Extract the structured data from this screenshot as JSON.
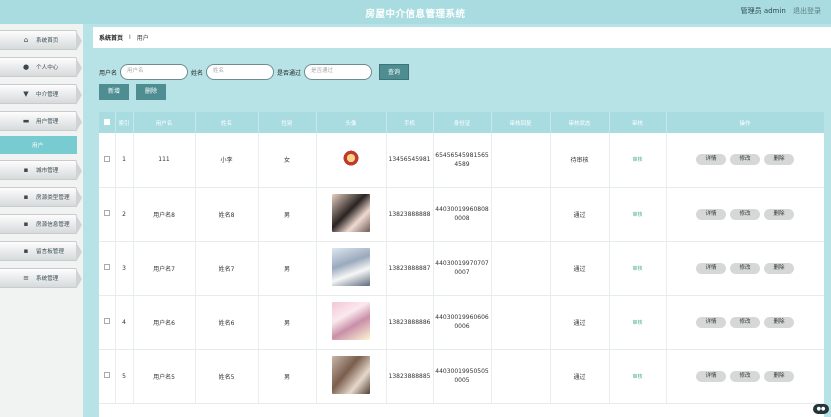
{
  "app": {
    "title": "房屋中介信息管理系统"
  },
  "header": {
    "user_label": "管理员 admin",
    "logout": "退出登录"
  },
  "sidebar": {
    "items": [
      {
        "label": "系统首页",
        "icon": "home-icon"
      },
      {
        "label": "个人中心",
        "icon": "user-icon"
      },
      {
        "label": "中介管理",
        "icon": "trophy-icon"
      },
      {
        "label": "用户管理",
        "icon": "briefcase-icon",
        "submenu": "用户"
      },
      {
        "label": "城市管理",
        "icon": "grid-icon"
      },
      {
        "label": "房源类型管理",
        "icon": "grid-icon"
      },
      {
        "label": "房源信息管理",
        "icon": "grid-icon"
      },
      {
        "label": "留言板管理",
        "icon": "grid-icon"
      },
      {
        "label": "系统管理",
        "icon": "list-icon"
      }
    ]
  },
  "breadcrumb": {
    "home": "系统首页",
    "separator": "I",
    "current": "用户"
  },
  "search": {
    "fields": [
      {
        "label": "用户名",
        "placeholder": "用户名"
      },
      {
        "label": "姓名",
        "placeholder": "姓名"
      },
      {
        "label": "是否通过",
        "placeholder": "是否通过"
      }
    ],
    "button": "查询"
  },
  "actions": {
    "add": "新增",
    "delete": "删除"
  },
  "table": {
    "headers": [
      "",
      "索引",
      "用户名",
      "姓名",
      "性别",
      "头像",
      "手机",
      "身份证",
      "审核回复",
      "审核状态",
      "审核",
      "操作"
    ],
    "rows": [
      {
        "index": "1",
        "username": "111",
        "name": "小李",
        "gender": "女",
        "phone": "13456545981",
        "id_card_1": "65456545981565",
        "id_card_2": "4589",
        "reply": "",
        "status": "待审核",
        "review": "审核"
      },
      {
        "index": "2",
        "username": "用户名8",
        "name": "姓名8",
        "gender": "男",
        "phone": "13823888888",
        "id_card_1": "44030019960808",
        "id_card_2": "0008",
        "reply": "",
        "status": "通过",
        "review": "审核"
      },
      {
        "index": "3",
        "username": "用户名7",
        "name": "姓名7",
        "gender": "男",
        "phone": "13823888887",
        "id_card_1": "44030019970707",
        "id_card_2": "0007",
        "reply": "",
        "status": "通过",
        "review": "审核"
      },
      {
        "index": "4",
        "username": "用户名6",
        "name": "姓名6",
        "gender": "男",
        "phone": "13823888886",
        "id_card_1": "44030019960606",
        "id_card_2": "0006",
        "reply": "",
        "status": "通过",
        "review": "审核"
      },
      {
        "index": "5",
        "username": "用户名5",
        "name": "姓名5",
        "gender": "男",
        "phone": "13823888885",
        "id_card_1": "44030019950505",
        "id_card_2": "0005",
        "reply": "",
        "status": "通过",
        "review": "审核"
      }
    ],
    "ops": {
      "detail": "详情",
      "edit": "修改",
      "delete": "删除"
    }
  },
  "colors": {
    "header_bg": "#a9dce0",
    "accent": "#4e8e92",
    "active_menu": "#78cbd1"
  }
}
